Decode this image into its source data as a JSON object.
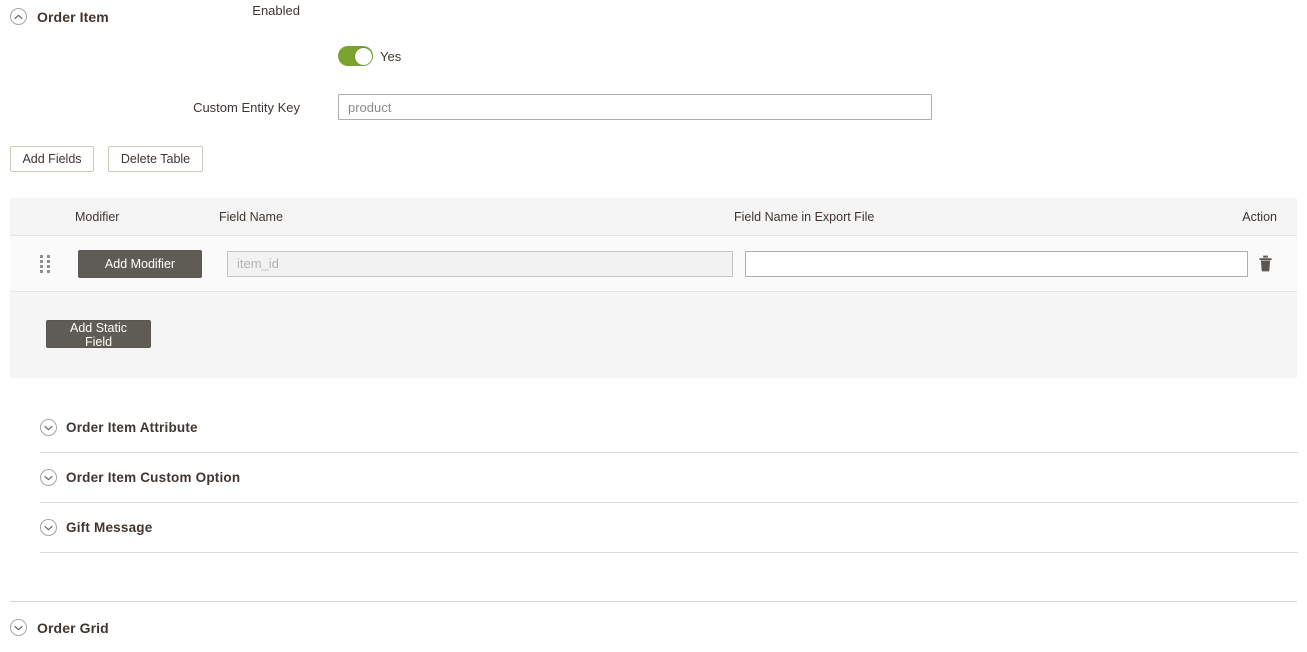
{
  "main_section": {
    "title": "Order Item",
    "collapse_icon": "chevron-up-circle-icon",
    "expanded": true
  },
  "form": {
    "enabled": {
      "label": "Enabled",
      "value_text": "Yes",
      "toggle_on": true,
      "toggle_color": "#79a22e"
    },
    "custom_entity_key": {
      "label": "Custom Entity Key",
      "value": "product",
      "placeholder": "product"
    }
  },
  "toolbar": {
    "add_fields_label": "Add Fields",
    "delete_table_label": "Delete Table"
  },
  "table": {
    "columns": [
      "Modifier",
      "Field Name",
      "Field Name in Export File",
      "Action"
    ],
    "rows": [
      {
        "drag_handle_icon": "drag-dots-icon",
        "modifier_button_label": "Add Modifier",
        "field_name_value": "",
        "field_name_placeholder": "item_id",
        "export_name_value": "",
        "export_name_placeholder": "",
        "action_icon": "trash-icon"
      }
    ],
    "footer": {
      "add_static_field_label": "Add Static Field"
    }
  },
  "subsections": [
    {
      "title": "Order Item Attribute",
      "collapse_icon": "chevron-down-circle-icon",
      "expanded": false
    },
    {
      "title": "Order Item Custom Option",
      "collapse_icon": "chevron-down-circle-icon",
      "expanded": false
    },
    {
      "title": "Gift Message",
      "collapse_icon": "chevron-down-circle-icon",
      "expanded": false
    }
  ],
  "bottom_section": {
    "title": "Order Grid",
    "collapse_icon": "chevron-down-circle-icon",
    "expanded": false
  },
  "colors": {
    "accent_green": "#79a22e",
    "dark_button": "#5f5b55",
    "panel_bg": "#f5f5f5",
    "text": "#41362f"
  }
}
